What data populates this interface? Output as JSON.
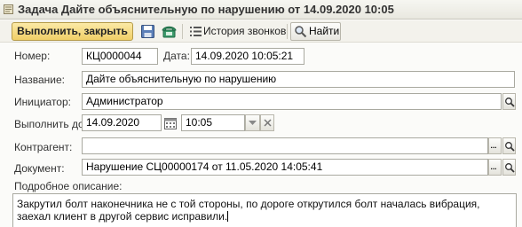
{
  "window": {
    "title": "Задача Дайте объяснительную по нарушению от 14.09.2020 10:05"
  },
  "toolbar": {
    "execute_close_label": "Выполнить, закрыть",
    "call_history_label": "История звонков",
    "find_label": "Найти"
  },
  "form": {
    "number_label": "Номер:",
    "number_value": "КЦ0000044",
    "date_label": "Дата:",
    "date_value": "14.09.2020 10:05:21",
    "name_label": "Название:",
    "name_value": "Дайте объяснительную по нарушению",
    "initiator_label": "Инициатор:",
    "initiator_value": "Администратор",
    "due_label": "Выполнить до:",
    "due_date_value": "14.09.2020",
    "due_time_value": "10:05",
    "counterparty_label": "Контрагент:",
    "counterparty_value": "",
    "document_label": "Документ:",
    "document_value": "Нарушение СЦ00000174 от 11.05.2020 14:05:41",
    "description_label": "Подробное описание:",
    "description_value": "Закрутил болт наконечника не с той стороны, по дороге открутился болт началась вибрация, заехал клиент в другой сервис исправили."
  }
}
